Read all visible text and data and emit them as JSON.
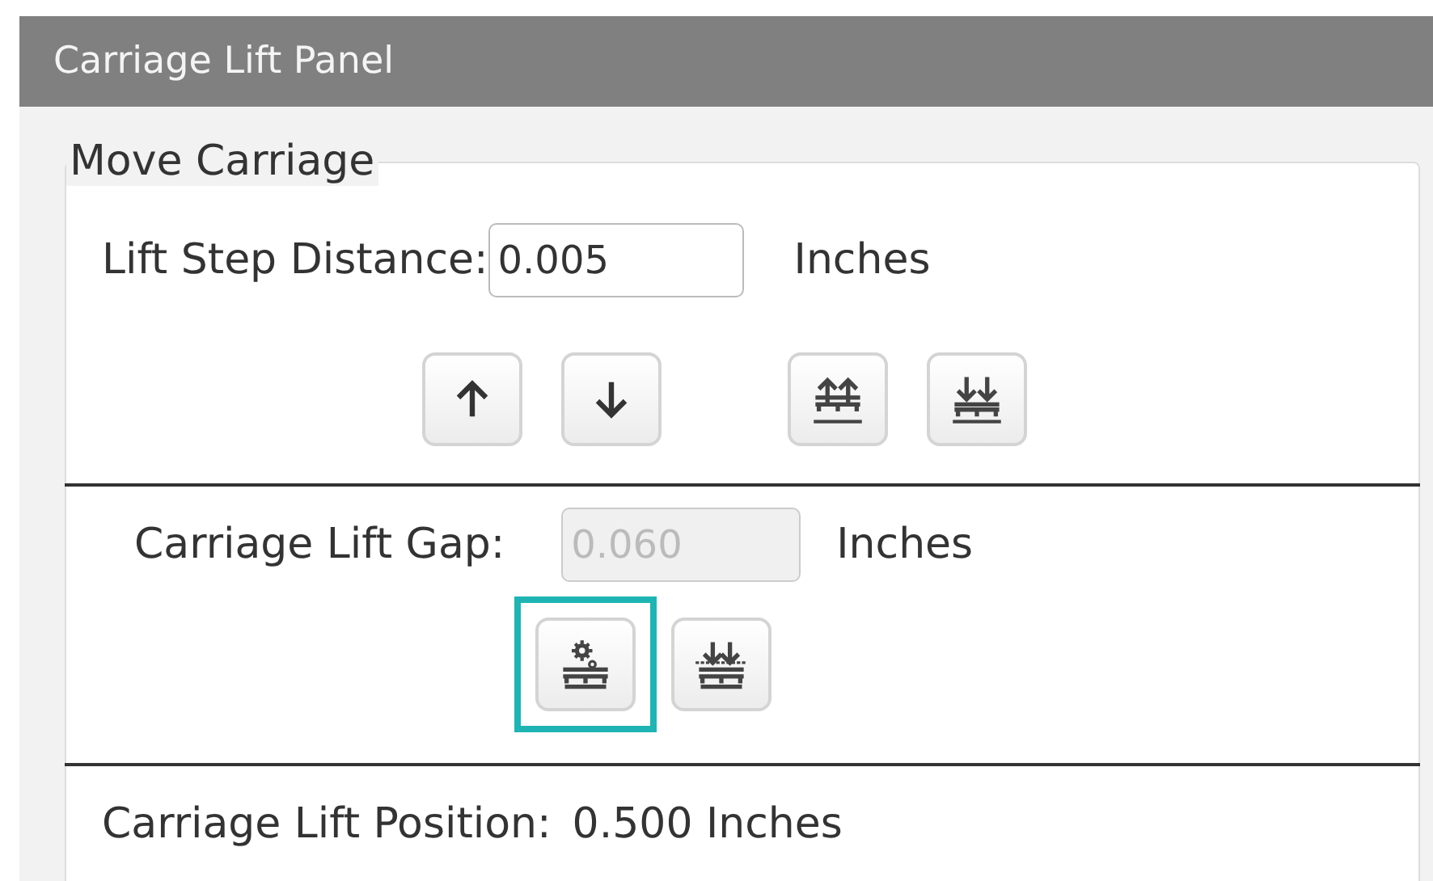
{
  "panel": {
    "title": "Carriage Lift Panel"
  },
  "move_carriage": {
    "title": "Move Carriage",
    "step": {
      "label": "Lift Step Distance:",
      "value": "0.005",
      "unit": "Inches"
    },
    "step_buttons": [
      {
        "kind": "up",
        "highlighted": false
      },
      {
        "kind": "down",
        "highlighted": false
      },
      {
        "kind": "raise-all",
        "highlighted": false
      },
      {
        "kind": "lower-all",
        "highlighted": false
      }
    ],
    "gap": {
      "label": "Carriage Lift Gap:",
      "value": "0.060",
      "unit": "Inches",
      "disabled": true
    },
    "gap_buttons": [
      {
        "kind": "gear-table",
        "highlighted": true
      },
      {
        "kind": "lower-gap",
        "highlighted": false
      }
    ],
    "position": {
      "label": "Carriage Lift Position:",
      "value": "0.500 Inches"
    }
  }
}
